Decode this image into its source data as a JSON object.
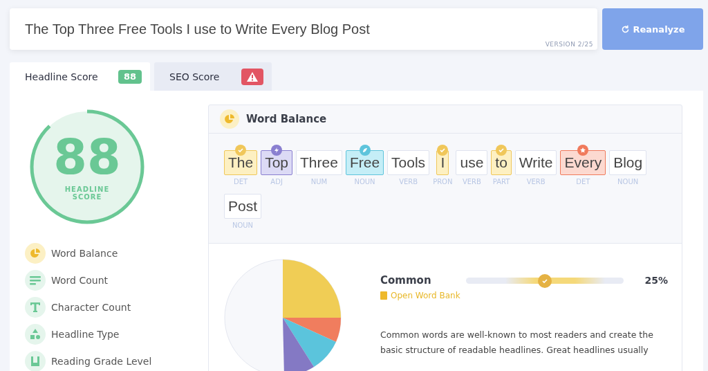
{
  "headline": {
    "value": "The Top Three Free Tools I use to Write Every Blog Post",
    "version": "VERSION 2/25"
  },
  "reanalyze_button": "Reanalyze",
  "tabs": [
    {
      "label": "Headline Score",
      "badge": "88",
      "kind": "score",
      "selected": true
    },
    {
      "label": "SEO Score",
      "kind": "warning",
      "selected": false
    }
  ],
  "score": {
    "value": "88",
    "label": "HEADLINE SCORE",
    "level": 0.88
  },
  "sidebar": {
    "items": [
      {
        "label": "Word Balance",
        "selected": true
      },
      {
        "label": "Word Count",
        "selected": false
      },
      {
        "label": "Character Count",
        "selected": false
      },
      {
        "label": "Headline Type",
        "selected": false
      },
      {
        "label": "Reading Grade Level",
        "selected": false
      }
    ]
  },
  "word_balance": {
    "title": "Word Balance",
    "words": [
      {
        "word": "The",
        "tag": "DET",
        "kind": "common"
      },
      {
        "word": "Top",
        "tag": "ADJ",
        "kind": "power"
      },
      {
        "word": "Three",
        "tag": "NUM",
        "kind": "neutral"
      },
      {
        "word": "Free",
        "tag": "NOUN",
        "kind": "emotional"
      },
      {
        "word": "Tools",
        "tag": "VERB",
        "kind": "neutral"
      },
      {
        "word": "I",
        "tag": "PRON",
        "kind": "common"
      },
      {
        "word": "use",
        "tag": "VERB",
        "kind": "neutral"
      },
      {
        "word": "to",
        "tag": "PART",
        "kind": "common"
      },
      {
        "word": "Write",
        "tag": "VERB",
        "kind": "neutral"
      },
      {
        "word": "Every",
        "tag": "DET",
        "kind": "uncommon"
      },
      {
        "word": "Blog",
        "tag": "NOUN",
        "kind": "neutral"
      },
      {
        "word": "Post",
        "tag": "NOUN",
        "kind": "neutral"
      }
    ],
    "category": {
      "name": "Common",
      "link": "Open Word Bank",
      "level": 0.5,
      "percent": "25%",
      "description": "Common words are well-known to most readers and create the basic structure of readable headlines. Great headlines usually"
    }
  }
}
